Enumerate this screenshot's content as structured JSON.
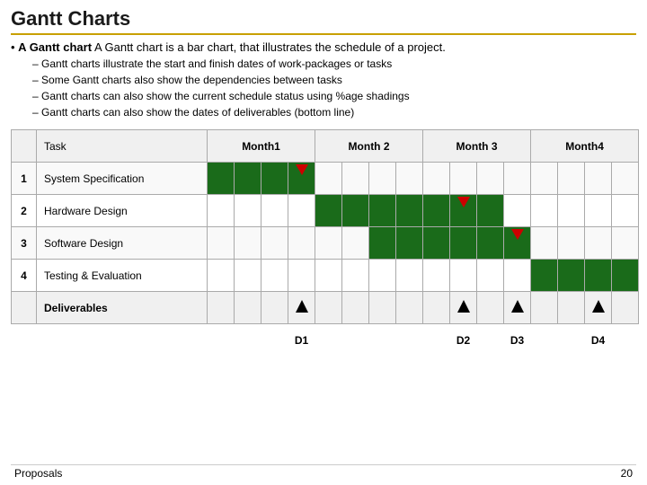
{
  "title": "Gantt Charts",
  "intro": {
    "bullet": "A Gantt chart is a bar chart, that illustrates the schedule of a project.",
    "sub": [
      "Gantt charts illustrate the start and finish dates of work-packages or tasks",
      "Some Gantt charts also show the dependencies between tasks",
      "Gantt charts can also show the current schedule status using %age shadings",
      "Gantt charts can also show the dates of deliverables (bottom line)"
    ]
  },
  "table": {
    "months": [
      "Month1",
      "Month 2",
      "Month 3",
      "Month4"
    ],
    "rows": [
      {
        "num": "1",
        "task": "System Specification",
        "cells": [
          1,
          1,
          1,
          1,
          0,
          0,
          0,
          0,
          0,
          0,
          0,
          0,
          0,
          0,
          0,
          0
        ],
        "marker": 4
      },
      {
        "num": "2",
        "task": "Hardware Design",
        "cells": [
          0,
          0,
          0,
          0,
          1,
          1,
          1,
          1,
          1,
          1,
          1,
          0,
          0,
          0,
          0,
          0
        ],
        "marker": 10
      },
      {
        "num": "3",
        "task": "Software Design",
        "cells": [
          0,
          0,
          0,
          0,
          0,
          0,
          1,
          1,
          1,
          1,
          1,
          1,
          0,
          0,
          0,
          0
        ],
        "marker": 12
      },
      {
        "num": "4",
        "task": "Testing & Evaluation",
        "cells": [
          0,
          0,
          0,
          0,
          0,
          0,
          0,
          0,
          0,
          0,
          0,
          0,
          1,
          1,
          1,
          1
        ],
        "marker": null
      }
    ],
    "deliverables_label": "Deliverables",
    "deliverables": [
      {
        "label": "D1",
        "col": 4
      },
      {
        "label": "D2",
        "col": 10
      },
      {
        "label": "D3",
        "col": 12
      },
      {
        "label": "D4",
        "col": 15
      }
    ]
  },
  "footer": {
    "left": "Proposals",
    "right": "20"
  }
}
